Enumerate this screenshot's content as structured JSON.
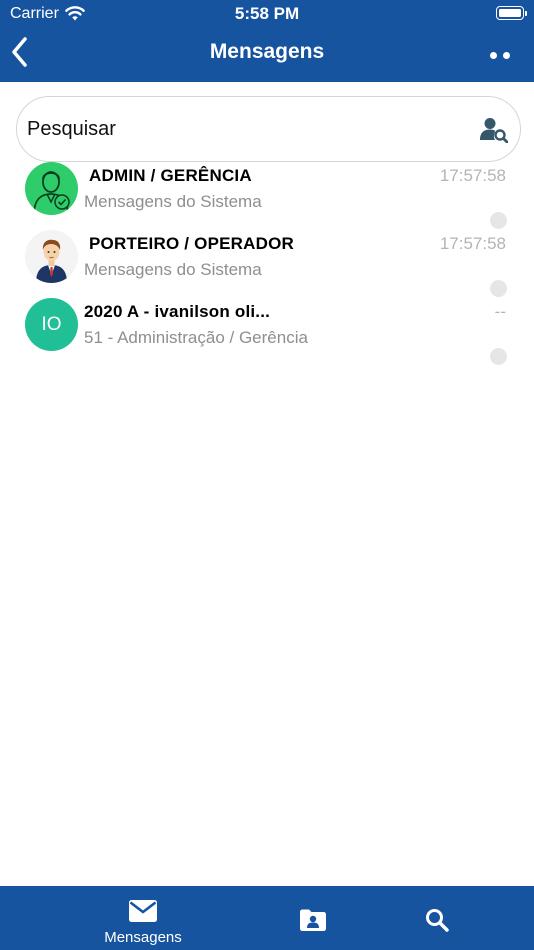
{
  "status_bar": {
    "carrier": "Carrier",
    "time": "5:58 PM"
  },
  "nav": {
    "title": "Mensagens"
  },
  "search": {
    "placeholder": "Pesquisar"
  },
  "conversations": [
    {
      "name": "ADMIN / GERÊNCIA",
      "subtitle": "Mensagens do Sistema",
      "time": "17:57:58",
      "avatar": "admin-avatar-icon"
    },
    {
      "name": "PORTEIRO / OPERADOR",
      "subtitle": "Mensagens do Sistema",
      "time": "17:57:58",
      "avatar": "doorman-avatar-icon"
    },
    {
      "name": "2020 A - ivanilson oli...",
      "subtitle": "51 - Administração / Gerência",
      "time": "--",
      "initials": "IO"
    }
  ],
  "tabbar": {
    "messages_label": "Mensagens"
  },
  "colors": {
    "primary": "#1754a0",
    "avatar_green": "#20bf96",
    "admin_green": "#2ecc6a",
    "secondary_text": "#8e8e93"
  }
}
